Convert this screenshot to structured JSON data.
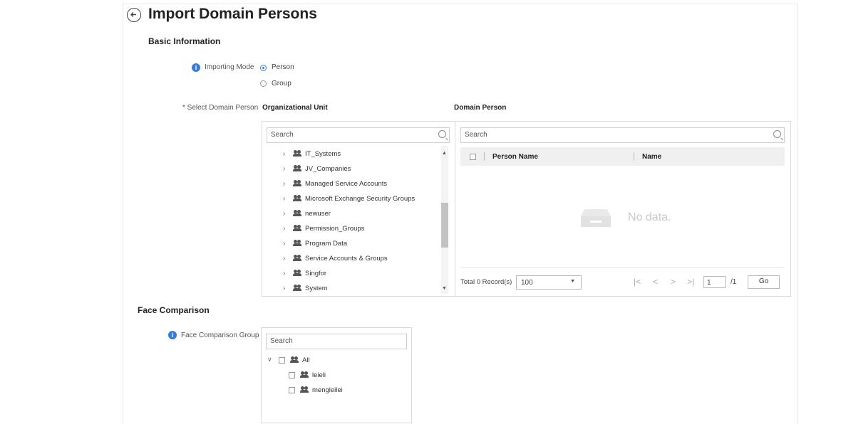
{
  "title": "Import Domain Persons",
  "basic_info": {
    "heading": "Basic Information",
    "importing_mode_label": "Importing Mode",
    "modes": [
      {
        "label": "Person",
        "selected": true
      },
      {
        "label": "Group",
        "selected": false
      }
    ],
    "select_label": "* Select Domain Person"
  },
  "org_unit": {
    "heading": "Organizational Unit",
    "search_placeholder": "Search",
    "items": [
      "IT_Systems",
      "JV_Companies",
      "Managed Service Accounts",
      "Microsoft Exchange Security Groups",
      "newuser",
      "Permission_Groups",
      "Program Data",
      "Service Accounts & Groups",
      "Singfor",
      "System"
    ]
  },
  "domain_person": {
    "heading": "Domain Person",
    "search_placeholder": "Search",
    "columns": [
      "Person Name",
      "Name"
    ],
    "empty_text": "No data.",
    "total": "Total 0 Record(s)",
    "page_size": "100",
    "page": "1",
    "page_total": "/1",
    "go_label": "Go"
  },
  "face": {
    "heading": "Face Comparison",
    "group_label": "Face Comparison Group",
    "search_placeholder": "Search",
    "root": "All",
    "children": [
      "leieli",
      "mengleilei"
    ]
  },
  "colors": {
    "accent": "#3a7bd5",
    "header_bg": "#f0f0f0"
  }
}
